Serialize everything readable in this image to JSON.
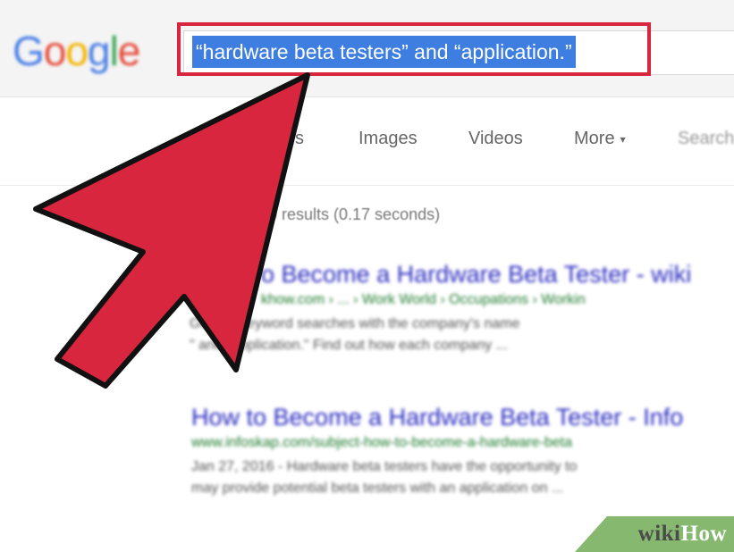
{
  "logo": {
    "letters": [
      "G",
      "o",
      "o",
      "g",
      "l",
      "e"
    ],
    "colors": [
      "#4a7fe6",
      "#e64b3b",
      "#f5b400",
      "#4a7fe6",
      "#3aa757",
      "#e64b3b"
    ]
  },
  "search": {
    "query": "“hardware beta testers” and “application.”"
  },
  "tabs": [
    {
      "label": "s"
    },
    {
      "label": "Images"
    },
    {
      "label": "Videos"
    },
    {
      "label": "More"
    },
    {
      "label": "Search"
    }
  ],
  "stats": {
    "text": "0 results (0.17 seconds)"
  },
  "results": [
    {
      "title": "o Become a Hardware Beta Tester - wiki",
      "url": "khow.com › ... › Work World › Occupations › Workin",
      "snippet1": "Google keyword searches with the company's name",
      "snippet2": "\" and \"application.\" Find out how each company ..."
    },
    {
      "title": "How to Become a Hardware Beta Tester - Info",
      "url": "www.infoskap.com/subject-how-to-become-a-hardware-beta",
      "snippet1": "Jan 27, 2016 - Hardware beta testers have the opportunity to",
      "snippet2": "may provide potential beta testers with an application on ..."
    }
  ],
  "watermark": {
    "part1": "wiki",
    "part2": "How"
  },
  "colors": {
    "arrow": "#d7263d",
    "highlight": "#d7263d",
    "selection": "#3d7ee0",
    "link": "#2a2ac0",
    "url": "#1d7a2e",
    "badge": "#86b86f"
  }
}
